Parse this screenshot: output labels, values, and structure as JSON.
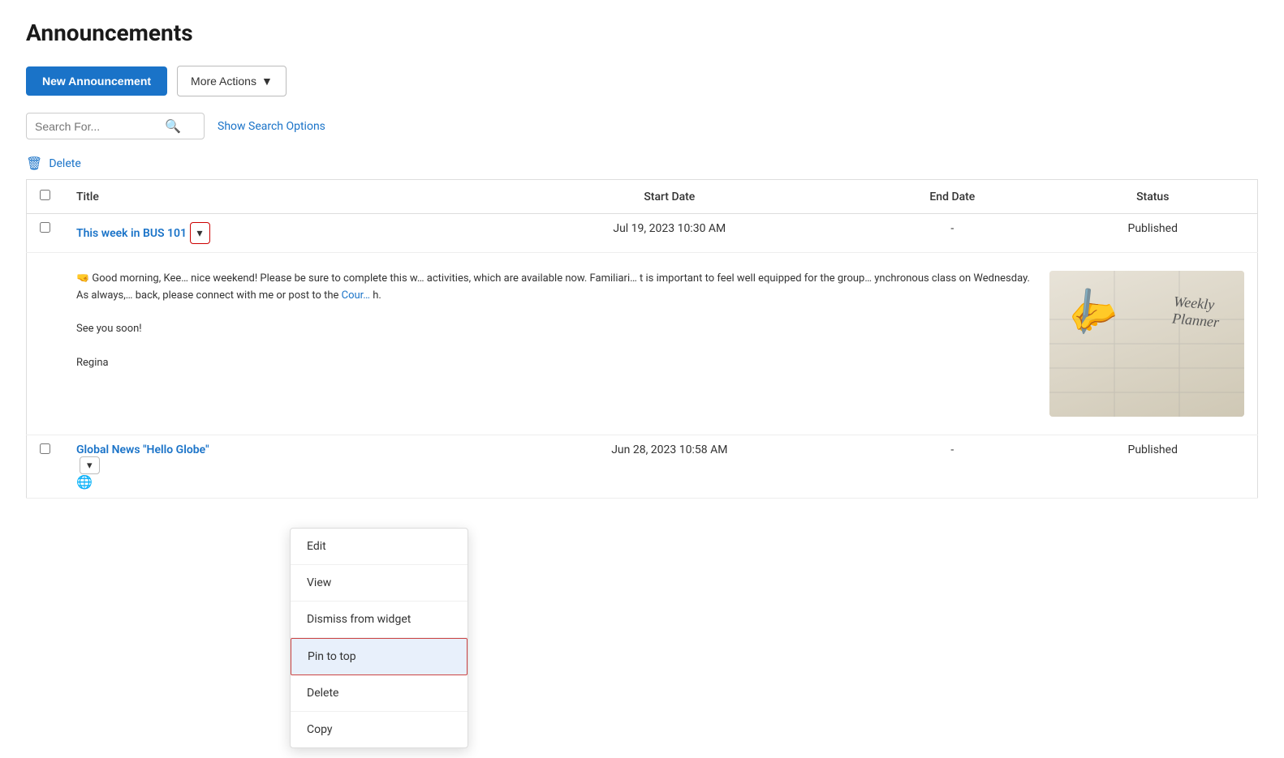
{
  "page": {
    "title": "Announcements"
  },
  "toolbar": {
    "new_announcement_label": "New Announcement",
    "more_actions_label": "More Actions",
    "more_actions_chevron": "▼"
  },
  "search": {
    "placeholder": "Search For...",
    "show_options_label": "Show Search Options"
  },
  "delete_bar": {
    "label": "Delete",
    "icon": "🗑"
  },
  "table": {
    "headers": [
      "",
      "Title",
      "Start Date",
      "End Date",
      "Status"
    ],
    "rows": [
      {
        "id": "row1",
        "title": "This week in BUS 101",
        "start_date": "Jul 19, 2023 10:30 AM",
        "end_date": "-",
        "status": "Published"
      },
      {
        "id": "row2",
        "title": "Global News \"Hello Globe\"",
        "start_date": "Jun 28, 2023 10:58 AM",
        "end_date": "-",
        "status": "Published"
      }
    ]
  },
  "preview": {
    "text_start": "🤜 Good morning, Kee… nice weekend! Please be sure to complete this w… activities, which are available now. Familiari… t is important to feel well equipped for the group… ynchronous class on Wednesday. As always,… back, please connect with me or post to the Cour… h.",
    "text_paragraph2": "See you soon!",
    "text_paragraph3": "Regina",
    "image_alt": "weekly planner with stylus"
  },
  "dropdown_menu": {
    "items": [
      {
        "id": "edit",
        "label": "Edit",
        "highlighted": false
      },
      {
        "id": "view",
        "label": "View",
        "highlighted": false
      },
      {
        "id": "dismiss",
        "label": "Dismiss from widget",
        "highlighted": false
      },
      {
        "id": "pin",
        "label": "Pin to top",
        "highlighted": true
      },
      {
        "id": "delete",
        "label": "Delete",
        "highlighted": false
      },
      {
        "id": "copy",
        "label": "Copy",
        "highlighted": false
      }
    ]
  },
  "colors": {
    "primary_blue": "#1a73c8",
    "border_red": "#c44",
    "highlight_blue": "#e8f0fb"
  }
}
